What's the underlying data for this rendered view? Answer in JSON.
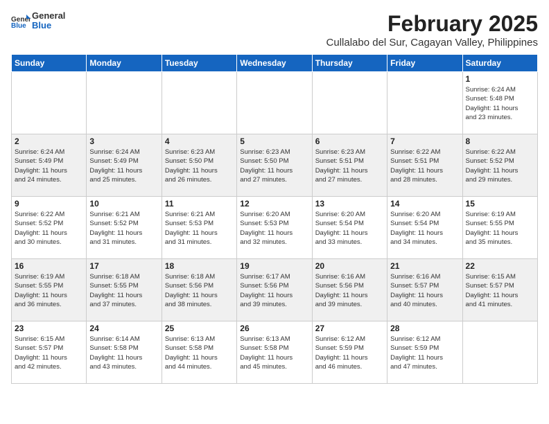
{
  "logo": {
    "line1": "General",
    "line2": "Blue"
  },
  "title": "February 2025",
  "subtitle": "Cullalabo del Sur, Cagayan Valley, Philippines",
  "weekdays": [
    "Sunday",
    "Monday",
    "Tuesday",
    "Wednesday",
    "Thursday",
    "Friday",
    "Saturday"
  ],
  "weeks": [
    [
      {
        "day": "",
        "info": ""
      },
      {
        "day": "",
        "info": ""
      },
      {
        "day": "",
        "info": ""
      },
      {
        "day": "",
        "info": ""
      },
      {
        "day": "",
        "info": ""
      },
      {
        "day": "",
        "info": ""
      },
      {
        "day": "1",
        "info": "Sunrise: 6:24 AM\nSunset: 5:48 PM\nDaylight: 11 hours\nand 23 minutes."
      }
    ],
    [
      {
        "day": "2",
        "info": "Sunrise: 6:24 AM\nSunset: 5:49 PM\nDaylight: 11 hours\nand 24 minutes."
      },
      {
        "day": "3",
        "info": "Sunrise: 6:24 AM\nSunset: 5:49 PM\nDaylight: 11 hours\nand 25 minutes."
      },
      {
        "day": "4",
        "info": "Sunrise: 6:23 AM\nSunset: 5:50 PM\nDaylight: 11 hours\nand 26 minutes."
      },
      {
        "day": "5",
        "info": "Sunrise: 6:23 AM\nSunset: 5:50 PM\nDaylight: 11 hours\nand 27 minutes."
      },
      {
        "day": "6",
        "info": "Sunrise: 6:23 AM\nSunset: 5:51 PM\nDaylight: 11 hours\nand 27 minutes."
      },
      {
        "day": "7",
        "info": "Sunrise: 6:22 AM\nSunset: 5:51 PM\nDaylight: 11 hours\nand 28 minutes."
      },
      {
        "day": "8",
        "info": "Sunrise: 6:22 AM\nSunset: 5:52 PM\nDaylight: 11 hours\nand 29 minutes."
      }
    ],
    [
      {
        "day": "9",
        "info": "Sunrise: 6:22 AM\nSunset: 5:52 PM\nDaylight: 11 hours\nand 30 minutes."
      },
      {
        "day": "10",
        "info": "Sunrise: 6:21 AM\nSunset: 5:52 PM\nDaylight: 11 hours\nand 31 minutes."
      },
      {
        "day": "11",
        "info": "Sunrise: 6:21 AM\nSunset: 5:53 PM\nDaylight: 11 hours\nand 31 minutes."
      },
      {
        "day": "12",
        "info": "Sunrise: 6:20 AM\nSunset: 5:53 PM\nDaylight: 11 hours\nand 32 minutes."
      },
      {
        "day": "13",
        "info": "Sunrise: 6:20 AM\nSunset: 5:54 PM\nDaylight: 11 hours\nand 33 minutes."
      },
      {
        "day": "14",
        "info": "Sunrise: 6:20 AM\nSunset: 5:54 PM\nDaylight: 11 hours\nand 34 minutes."
      },
      {
        "day": "15",
        "info": "Sunrise: 6:19 AM\nSunset: 5:55 PM\nDaylight: 11 hours\nand 35 minutes."
      }
    ],
    [
      {
        "day": "16",
        "info": "Sunrise: 6:19 AM\nSunset: 5:55 PM\nDaylight: 11 hours\nand 36 minutes."
      },
      {
        "day": "17",
        "info": "Sunrise: 6:18 AM\nSunset: 5:55 PM\nDaylight: 11 hours\nand 37 minutes."
      },
      {
        "day": "18",
        "info": "Sunrise: 6:18 AM\nSunset: 5:56 PM\nDaylight: 11 hours\nand 38 minutes."
      },
      {
        "day": "19",
        "info": "Sunrise: 6:17 AM\nSunset: 5:56 PM\nDaylight: 11 hours\nand 39 minutes."
      },
      {
        "day": "20",
        "info": "Sunrise: 6:16 AM\nSunset: 5:56 PM\nDaylight: 11 hours\nand 39 minutes."
      },
      {
        "day": "21",
        "info": "Sunrise: 6:16 AM\nSunset: 5:57 PM\nDaylight: 11 hours\nand 40 minutes."
      },
      {
        "day": "22",
        "info": "Sunrise: 6:15 AM\nSunset: 5:57 PM\nDaylight: 11 hours\nand 41 minutes."
      }
    ],
    [
      {
        "day": "23",
        "info": "Sunrise: 6:15 AM\nSunset: 5:57 PM\nDaylight: 11 hours\nand 42 minutes."
      },
      {
        "day": "24",
        "info": "Sunrise: 6:14 AM\nSunset: 5:58 PM\nDaylight: 11 hours\nand 43 minutes."
      },
      {
        "day": "25",
        "info": "Sunrise: 6:13 AM\nSunset: 5:58 PM\nDaylight: 11 hours\nand 44 minutes."
      },
      {
        "day": "26",
        "info": "Sunrise: 6:13 AM\nSunset: 5:58 PM\nDaylight: 11 hours\nand 45 minutes."
      },
      {
        "day": "27",
        "info": "Sunrise: 6:12 AM\nSunset: 5:59 PM\nDaylight: 11 hours\nand 46 minutes."
      },
      {
        "day": "28",
        "info": "Sunrise: 6:12 AM\nSunset: 5:59 PM\nDaylight: 11 hours\nand 47 minutes."
      },
      {
        "day": "",
        "info": ""
      }
    ]
  ]
}
